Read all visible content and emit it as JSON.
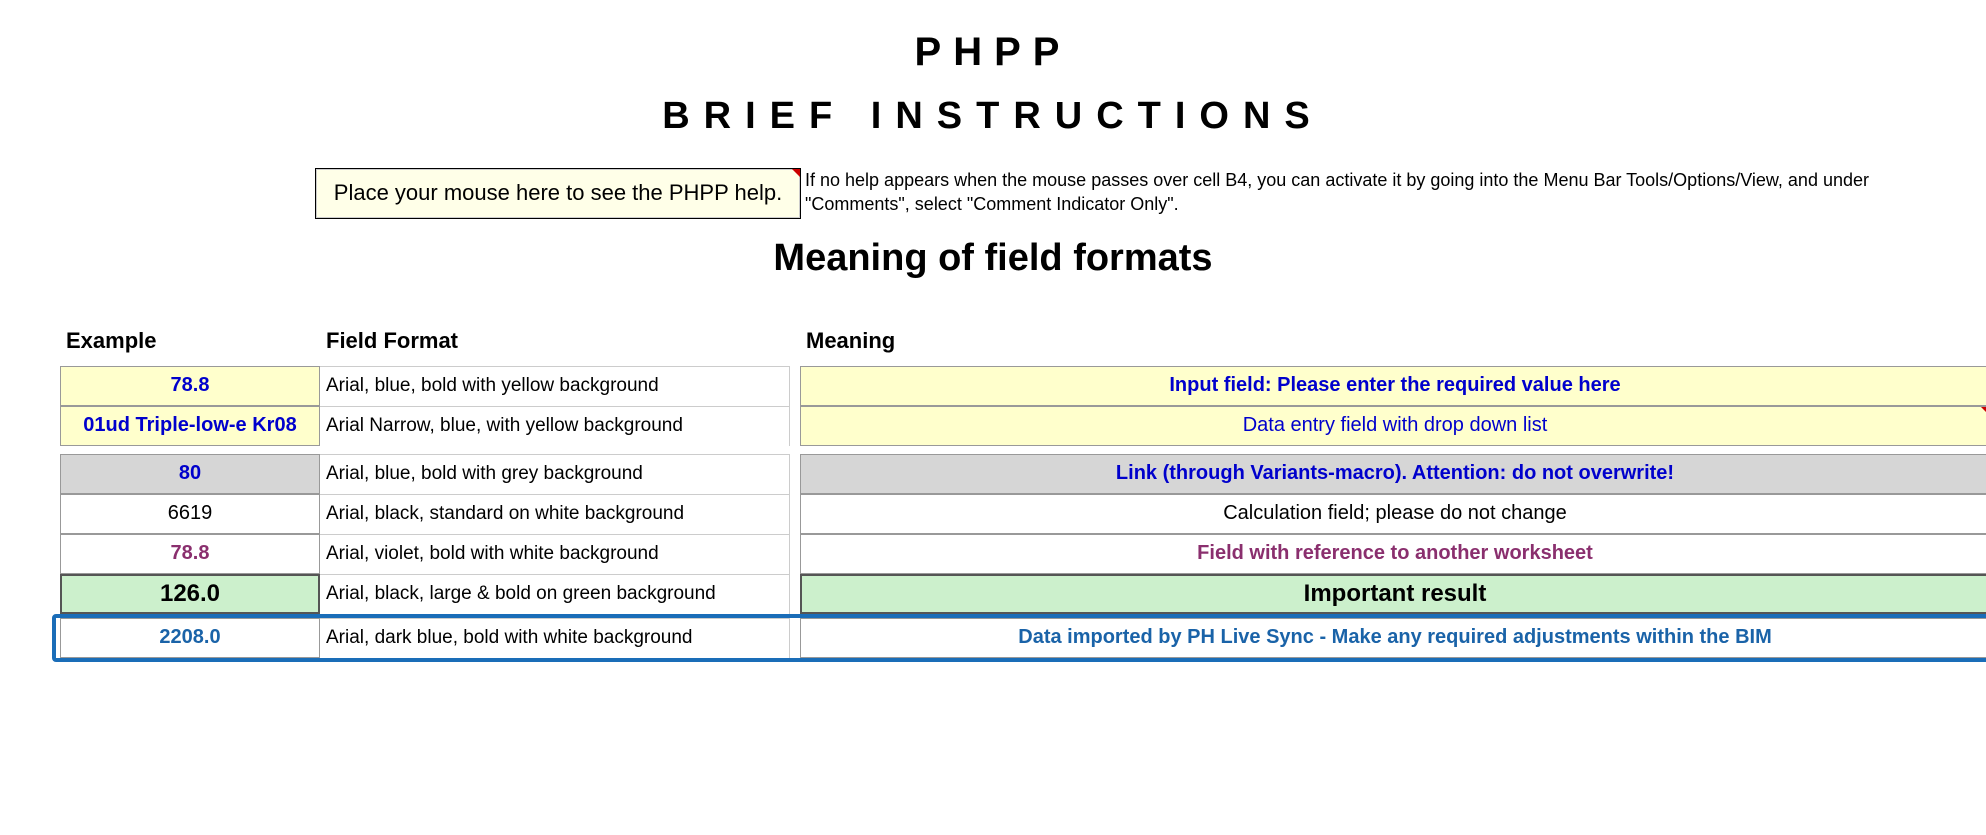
{
  "title1": "PHPP",
  "title2": "BRIEF   INSTRUCTIONS",
  "help_box": "Place your mouse here to see the PHPP help.",
  "help_desc": "If no help appears when the mouse passes over cell B4, you can activate it by going into the Menu Bar Tools/Options/View, and under \"Comments\", select \"Comment Indicator Only\".",
  "subtitle": "Meaning of field formats",
  "headers": {
    "example": "Example",
    "format": "Field Format",
    "meaning": "Meaning"
  },
  "rows": [
    {
      "example": "78.8",
      "format": "Arial, blue, bold with yellow background",
      "meaning": "Input field: Please enter the required value here"
    },
    {
      "example": "01ud Triple-low-e Kr08",
      "format": "Arial Narrow, blue, with yellow background",
      "meaning": "Data entry field with drop down list"
    },
    {
      "example": "80",
      "format": "Arial, blue, bold with grey background",
      "meaning": "Link (through Variants-macro). Attention: do not overwrite!"
    },
    {
      "example": "6619",
      "format": "Arial, black, standard on white background",
      "meaning": "Calculation field; please do not change"
    },
    {
      "example": "78.8",
      "format": "Arial, violet, bold with white background",
      "meaning": "Field with reference to another worksheet"
    },
    {
      "example": "126.0",
      "format": "Arial, black, large & bold on green background",
      "meaning": "Important result"
    },
    {
      "example": "2208.0",
      "format": "Arial, dark blue, bold with white background",
      "meaning": "Data imported by PH Live Sync - Make any required adjustments within the BIM"
    }
  ]
}
